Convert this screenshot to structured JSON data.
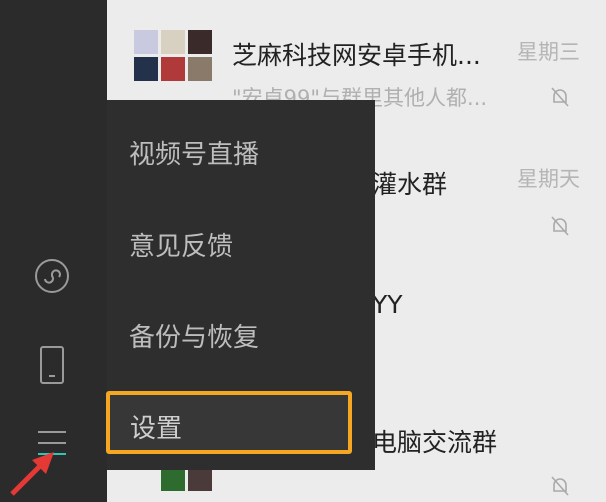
{
  "sidebar": {
    "icons": [
      "mini-program-icon",
      "phone-icon",
      "menu-icon"
    ]
  },
  "chats": [
    {
      "title": "芝麻科技网安卓手机...",
      "time": "星期三",
      "preview": "\"安卓99\"与群里其他人都...",
      "muted": true
    },
    {
      "title": "灌水群",
      "time": "星期天",
      "preview": "",
      "muted": true
    },
    {
      "title": "YY",
      "time": "",
      "preview": "",
      "muted": false
    },
    {
      "title": "电脑交流群",
      "time": "",
      "preview": "",
      "muted": true
    }
  ],
  "menu": {
    "items": [
      "视频号直播",
      "意见反馈",
      "备份与恢复",
      "设置"
    ],
    "highlighted": "设置"
  },
  "colors": {
    "highlight": "#f5a623",
    "arrow": "#e53935"
  }
}
